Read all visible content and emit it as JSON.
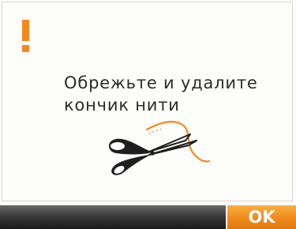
{
  "dialog": {
    "message_line1": "Обрежьте и удалите",
    "message_line2": "кончик нити",
    "alert_icon": "exclamation-icon",
    "illustration_icon": "scissors-cutting-thread-icon"
  },
  "footer": {
    "ok_label": "OK"
  },
  "colors": {
    "accent": "#f28a1f",
    "text": "#2b2b2b",
    "bar_dark": "#2a2a2a"
  }
}
